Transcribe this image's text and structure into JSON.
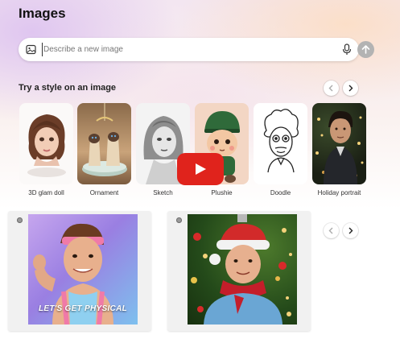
{
  "page": {
    "title": "Images"
  },
  "search": {
    "placeholder": "Describe a new image",
    "value": ""
  },
  "styles": {
    "heading": "Try a style on an image",
    "items": [
      {
        "label": "3D glam doll"
      },
      {
        "label": "Ornament"
      },
      {
        "label": "Sketch"
      },
      {
        "label": "Plushie"
      },
      {
        "label": "Doodle"
      },
      {
        "label": "Holiday portrait"
      }
    ]
  },
  "results": [
    {
      "caption": "LET'S GET PHYSICAL"
    },
    {
      "caption": ""
    }
  ],
  "icons": {
    "image": "image-icon",
    "mic": "microphone-icon",
    "send": "arrow-up-icon",
    "prev": "chevron-left-icon",
    "next": "chevron-right-icon",
    "video": "youtube-play-icon"
  },
  "colors": {
    "youtube_red": "#e0231c",
    "send_button": "#b3b3b3"
  }
}
